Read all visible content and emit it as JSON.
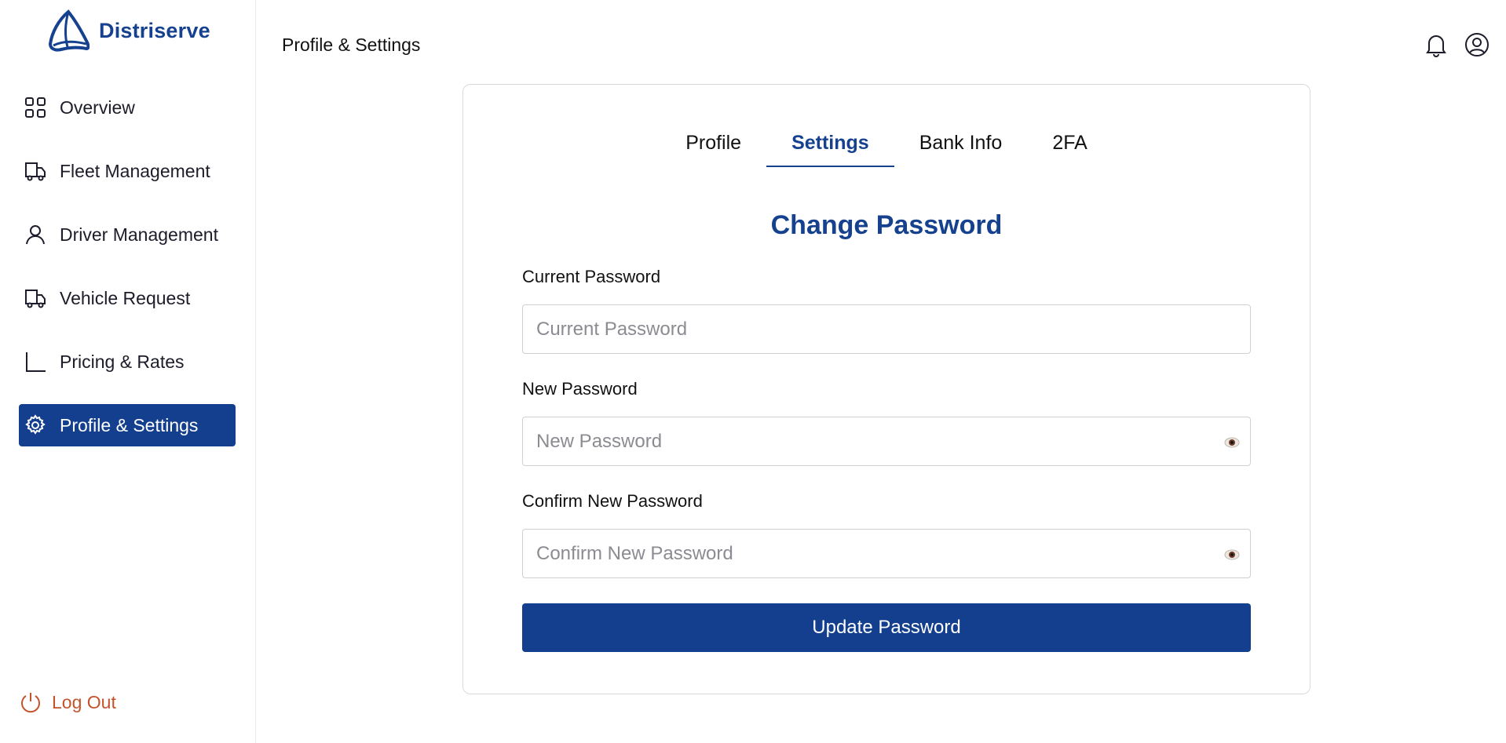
{
  "app": {
    "brand": "Distriserve",
    "colors": {
      "primary": "#143f8e",
      "logout": "#c4532b"
    }
  },
  "sidebar": {
    "items": [
      {
        "label": "Overview",
        "icon": "grid-icon"
      },
      {
        "label": "Fleet Management",
        "icon": "truck-icon"
      },
      {
        "label": "Driver Management",
        "icon": "user-icon"
      },
      {
        "label": "Vehicle Request",
        "icon": "truck-icon"
      },
      {
        "label": "Pricing & Rates",
        "icon": "chart-axis-icon"
      },
      {
        "label": "Profile & Settings",
        "icon": "gear-icon",
        "active": true
      }
    ],
    "logout_label": "Log Out"
  },
  "header": {
    "title": "Profile & Settings",
    "icons": [
      "bell-icon",
      "user-circle-icon"
    ]
  },
  "card": {
    "tabs": [
      {
        "label": "Profile"
      },
      {
        "label": "Settings",
        "active": true
      },
      {
        "label": "Bank Info"
      },
      {
        "label": "2FA"
      }
    ],
    "form_title": "Change Password",
    "fields": {
      "current": {
        "label": "Current Password",
        "placeholder": "Current Password",
        "value": ""
      },
      "new": {
        "label": "New Password",
        "placeholder": "New Password",
        "value": ""
      },
      "confirm": {
        "label": "Confirm New Password",
        "placeholder": "Confirm New Password",
        "value": ""
      }
    },
    "submit_label": "Update Password"
  }
}
